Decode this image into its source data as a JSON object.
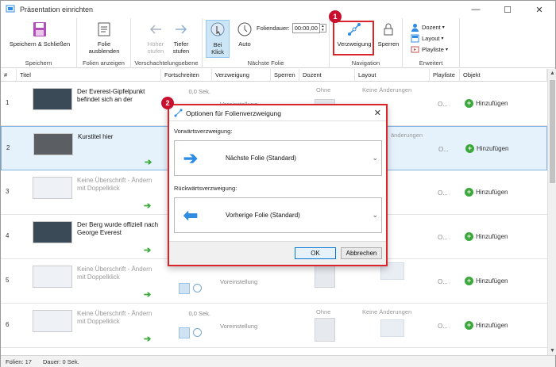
{
  "window": {
    "title": "Präsentation einrichten",
    "controls": {
      "minimize": "—",
      "maximize": "☐",
      "close": "✕"
    }
  },
  "ribbon": {
    "groups": [
      {
        "label": "Speichern"
      },
      {
        "label": "Folien anzeigen"
      },
      {
        "label": "Verschachtelungsebene"
      },
      {
        "label": "Nächste Folie"
      },
      {
        "label": "Navigation"
      },
      {
        "label": "Erweitert"
      }
    ],
    "buttons": {
      "save_close": "Speichern & Schließen",
      "hide_slide_1": "Folie",
      "hide_slide_2": "ausblenden",
      "higher_1": "Höher",
      "higher_2": "stufen",
      "lower_1": "Tiefer",
      "lower_2": "stufen",
      "on_click_1": "Bei",
      "on_click_2": "Klick",
      "auto": "Auto",
      "slide_duration_label": "Foliendauer:",
      "slide_duration_value": "00:00,00",
      "branching": "Verzweigung",
      "lock": "Sperren",
      "presenter": "Dozent",
      "layout": "Layout",
      "playlist": "Playliste"
    },
    "badge1": "1"
  },
  "table": {
    "headers": [
      "#",
      "Titel",
      "Fortschreiten",
      "Verzweigung",
      "Sperren",
      "Dozent",
      "Layout",
      "Playliste",
      "Objekt"
    ],
    "rows": [
      {
        "num": "1",
        "title": "Der Everest-Gipfelpunkt befindet sich an der",
        "gray": false,
        "dark": true,
        "progress": "0,0 Sek.",
        "branch": "Voreinstellung",
        "presenter": "Ohne",
        "layout": "Keine Änderungen",
        "playlist": "O...",
        "object": "Hinzufügen"
      },
      {
        "num": "2",
        "title": "Kurstitel hier",
        "gray": false,
        "dark": true,
        "progress": "",
        "branch": "",
        "presenter": "",
        "layout": "änderungen",
        "playlist": "O...",
        "object": "Hinzufügen"
      },
      {
        "num": "3",
        "title": "Keine Überschrift - Ändern mit Doppelklick",
        "gray": true,
        "dark": false,
        "progress": "",
        "branch": "",
        "presenter": "",
        "layout": "",
        "playlist": "O...",
        "object": "Hinzufügen"
      },
      {
        "num": "4",
        "title": "Der Berg wurde offiziell nach George Everest",
        "gray": false,
        "dark": true,
        "progress": "",
        "branch": "",
        "presenter": "",
        "layout": "",
        "playlist": "O...",
        "object": "Hinzufügen"
      },
      {
        "num": "5",
        "title": "Keine Überschrift - Ändern mit Doppelklick",
        "gray": true,
        "dark": false,
        "progress": "",
        "branch": "Voreinstellung",
        "presenter": "",
        "layout": "",
        "playlist": "O...",
        "object": "Hinzufügen"
      },
      {
        "num": "6",
        "title": "Keine Überschrift - Ändern mit Doppelklick",
        "gray": true,
        "dark": false,
        "progress": "0,0 Sek.",
        "branch": "Voreinstellung",
        "presenter": "Ohne",
        "layout": "Keine Änderungen",
        "playlist": "O...",
        "object": "Hinzufügen"
      }
    ]
  },
  "status": {
    "slides": "Folien: 17",
    "duration": "Dauer: 0 Sek."
  },
  "dialog": {
    "title": "Optionen für Folienverzweigung",
    "badge": "2",
    "forward_label": "Vorwärtsverzweigung:",
    "forward_value": "Nächste Folie (Standard)",
    "backward_label": "Rückwärtsverzweigung:",
    "backward_value": "Vorherige Folie (Standard)",
    "ok": "OK",
    "cancel": "Abbrechen"
  },
  "colors": {
    "accent": "#2e8de3",
    "highlight": "#d9252a",
    "green": "#3aa93a"
  }
}
